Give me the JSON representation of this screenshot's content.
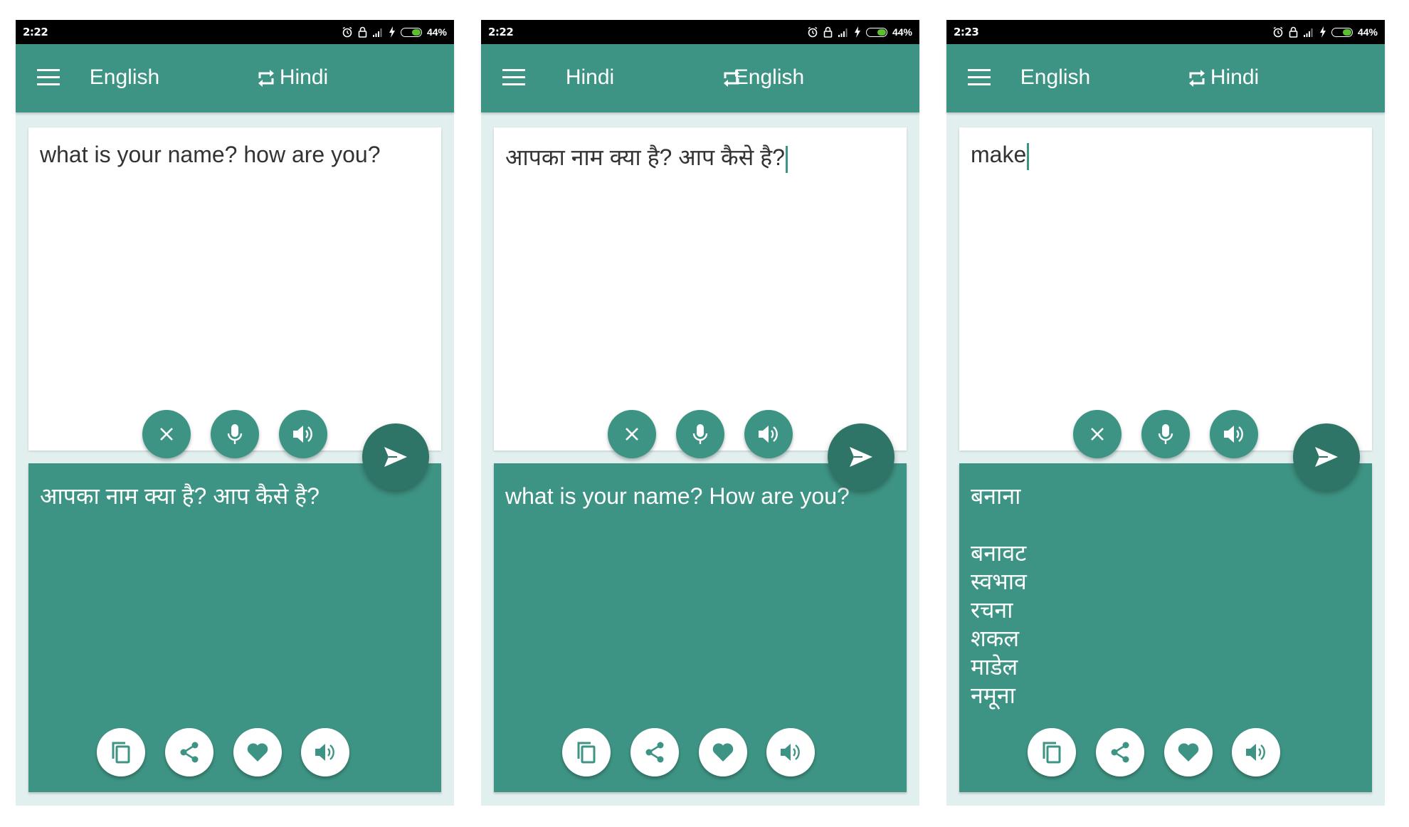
{
  "colors": {
    "primary": "#3e9484",
    "primary_dark": "#2f7567",
    "background": "#e1efee",
    "status_bar": "#000000",
    "battery_fill": "#5bbf2e"
  },
  "screens": [
    {
      "status": {
        "time": "2:22",
        "battery": "44%",
        "icons": [
          "alarm-icon",
          "lock-icon",
          "signal-icon",
          "charging-icon",
          "battery-icon"
        ]
      },
      "toolbar": {
        "source_language": "English",
        "target_language": "Hindi",
        "icons": [
          "menu-icon",
          "swap-icon"
        ]
      },
      "input": {
        "text": "what is your name? how are you?",
        "cursor": false,
        "buttons": [
          "clear-icon",
          "mic-icon",
          "speaker-icon"
        ]
      },
      "translate_button": "send-icon",
      "output": {
        "lines": [
          "आपका नाम क्या है? आप कैसे है?"
        ],
        "buttons": [
          "copy-icon",
          "share-icon",
          "favorite-icon",
          "speaker-icon"
        ]
      }
    },
    {
      "status": {
        "time": "2:22",
        "battery": "44%",
        "icons": [
          "alarm-icon",
          "lock-icon",
          "signal-icon",
          "charging-icon",
          "battery-icon"
        ]
      },
      "toolbar": {
        "source_language": "Hindi",
        "target_language": "English",
        "icons": [
          "menu-icon",
          "swap-icon"
        ]
      },
      "input": {
        "text": "आपका नाम क्या है? आप कैसे है?",
        "cursor": true,
        "buttons": [
          "clear-icon",
          "mic-icon",
          "speaker-icon"
        ]
      },
      "translate_button": "send-icon",
      "output": {
        "lines": [
          "what is your name? How are you?"
        ],
        "buttons": [
          "copy-icon",
          "share-icon",
          "favorite-icon",
          "speaker-icon"
        ]
      }
    },
    {
      "status": {
        "time": "2:23",
        "battery": "44%",
        "icons": [
          "alarm-icon",
          "lock-icon",
          "signal-icon",
          "charging-icon",
          "battery-icon"
        ]
      },
      "toolbar": {
        "source_language": "English",
        "target_language": "Hindi",
        "icons": [
          "menu-icon",
          "swap-icon"
        ]
      },
      "input": {
        "text": "make",
        "cursor": true,
        "buttons": [
          "clear-icon",
          "mic-icon",
          "speaker-icon"
        ]
      },
      "translate_button": "send-icon",
      "output": {
        "lines": [
          "बनाना",
          "",
          "बनावट",
          "स्वभाव",
          "रचना",
          "शकल",
          "माडेल",
          "नमूना"
        ],
        "buttons": [
          "copy-icon",
          "share-icon",
          "favorite-icon",
          "speaker-icon"
        ]
      }
    }
  ]
}
